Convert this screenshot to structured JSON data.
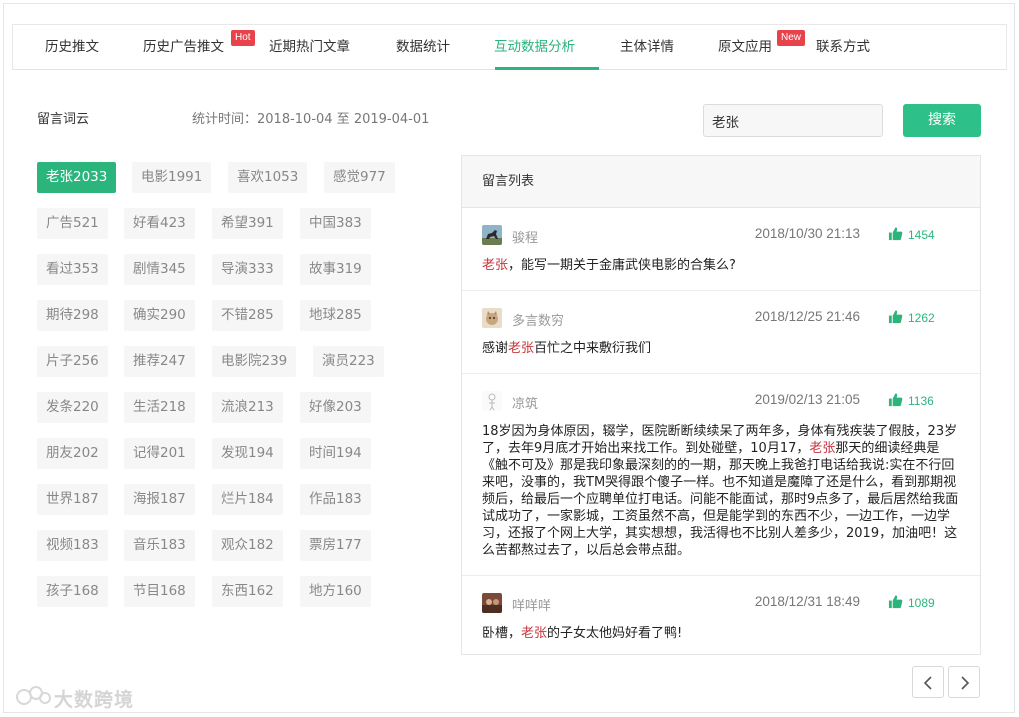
{
  "nav": {
    "tabs": [
      {
        "label": "历史推文",
        "badge": ""
      },
      {
        "label": "历史广告推文",
        "badge": "Hot"
      },
      {
        "label": "近期热门文章",
        "badge": ""
      },
      {
        "label": "数据统计",
        "badge": ""
      },
      {
        "label": "互动数据分析",
        "badge": "",
        "active": true
      },
      {
        "label": "主体详情",
        "badge": ""
      },
      {
        "label": "原文应用",
        "badge": "New"
      },
      {
        "label": "联系方式",
        "badge": ""
      }
    ]
  },
  "wordcloud": {
    "title": "留言词云",
    "stat_time": "统计时间：2018-10-04 至 2019-04-01",
    "tags": [
      {
        "label": "老张2033",
        "active": true
      },
      {
        "label": "电影1991"
      },
      {
        "label": "喜欢1053"
      },
      {
        "label": "感觉977"
      },
      {
        "label": "广告521"
      },
      {
        "label": "好看423"
      },
      {
        "label": "希望391"
      },
      {
        "label": "中国383"
      },
      {
        "label": "看过353"
      },
      {
        "label": "剧情345"
      },
      {
        "label": "导演333"
      },
      {
        "label": "故事319"
      },
      {
        "label": "期待298"
      },
      {
        "label": "确实290"
      },
      {
        "label": "不错285"
      },
      {
        "label": "地球285"
      },
      {
        "label": "片子256"
      },
      {
        "label": "推荐247"
      },
      {
        "label": "电影院239"
      },
      {
        "label": "演员223"
      },
      {
        "label": "发条220"
      },
      {
        "label": "生活218"
      },
      {
        "label": "流浪213"
      },
      {
        "label": "好像203"
      },
      {
        "label": "朋友202"
      },
      {
        "label": "记得201"
      },
      {
        "label": "发现194"
      },
      {
        "label": "时间194"
      },
      {
        "label": "世界187"
      },
      {
        "label": "海报187"
      },
      {
        "label": "烂片184"
      },
      {
        "label": "作品183"
      },
      {
        "label": "视频183"
      },
      {
        "label": "音乐183"
      },
      {
        "label": "观众182"
      },
      {
        "label": "票房177"
      },
      {
        "label": "孩子168"
      },
      {
        "label": "节目168"
      },
      {
        "label": "东西162"
      },
      {
        "label": "地方160"
      }
    ]
  },
  "search": {
    "value": "老张",
    "button_label": "搜索"
  },
  "comments": {
    "header": "留言列表",
    "keyword": "老张",
    "items": [
      {
        "user": "骏程",
        "time": "2018/10/30 21:13",
        "likes": "1454",
        "avatar": "horse",
        "text": "老张，能写一期关于金庸武侠电影的合集么?"
      },
      {
        "user": "多言数穷",
        "time": "2018/12/25 21:46",
        "likes": "1262",
        "avatar": "cat",
        "text": "感谢老张百忙之中来敷衍我们"
      },
      {
        "user": "凉筑",
        "time": "2019/02/13 21:05",
        "likes": "1136",
        "avatar": "sketch",
        "text": "18岁因为身体原因，辍学，医院断断续续呆了两年多，身体有残疾装了假肢，23岁了，去年9月底才开始出来找工作。到处碰壁，10月17，老张那天的细读经典是《触不可及》那是我印象最深刻的的一期，那天晚上我爸打电话给我说:实在不行回来吧，没事的，我TM哭得跟个傻子一样。也不知道是魔障了还是什么，看到那期视频后，给最后一个应聘单位打电话。问能不能面试，那时9点多了，最后居然给我面试成功了，一家影城，工资虽然不高，但是能学到的东西不少，一边工作，一边学习，还报了个网上大学，其实想想，我活得也不比别人差多少，2019，加油吧！这么苦都熬过去了，以后总会带点甜。"
      },
      {
        "user": "咩咩咩",
        "time": "2018/12/31 18:49",
        "likes": "1089",
        "avatar": "photo",
        "text": "卧槽，老张的子女太他妈好看了鸭!"
      }
    ]
  },
  "pager": {
    "prev_icon": "chevron-left-icon",
    "next_icon": "chevron-right-icon"
  },
  "watermark": {
    "text": "大数跨境"
  },
  "colors": {
    "accent": "#2bb57d",
    "button": "#2dc189",
    "keyword": "#c7353d",
    "badge": "#e8434b"
  }
}
